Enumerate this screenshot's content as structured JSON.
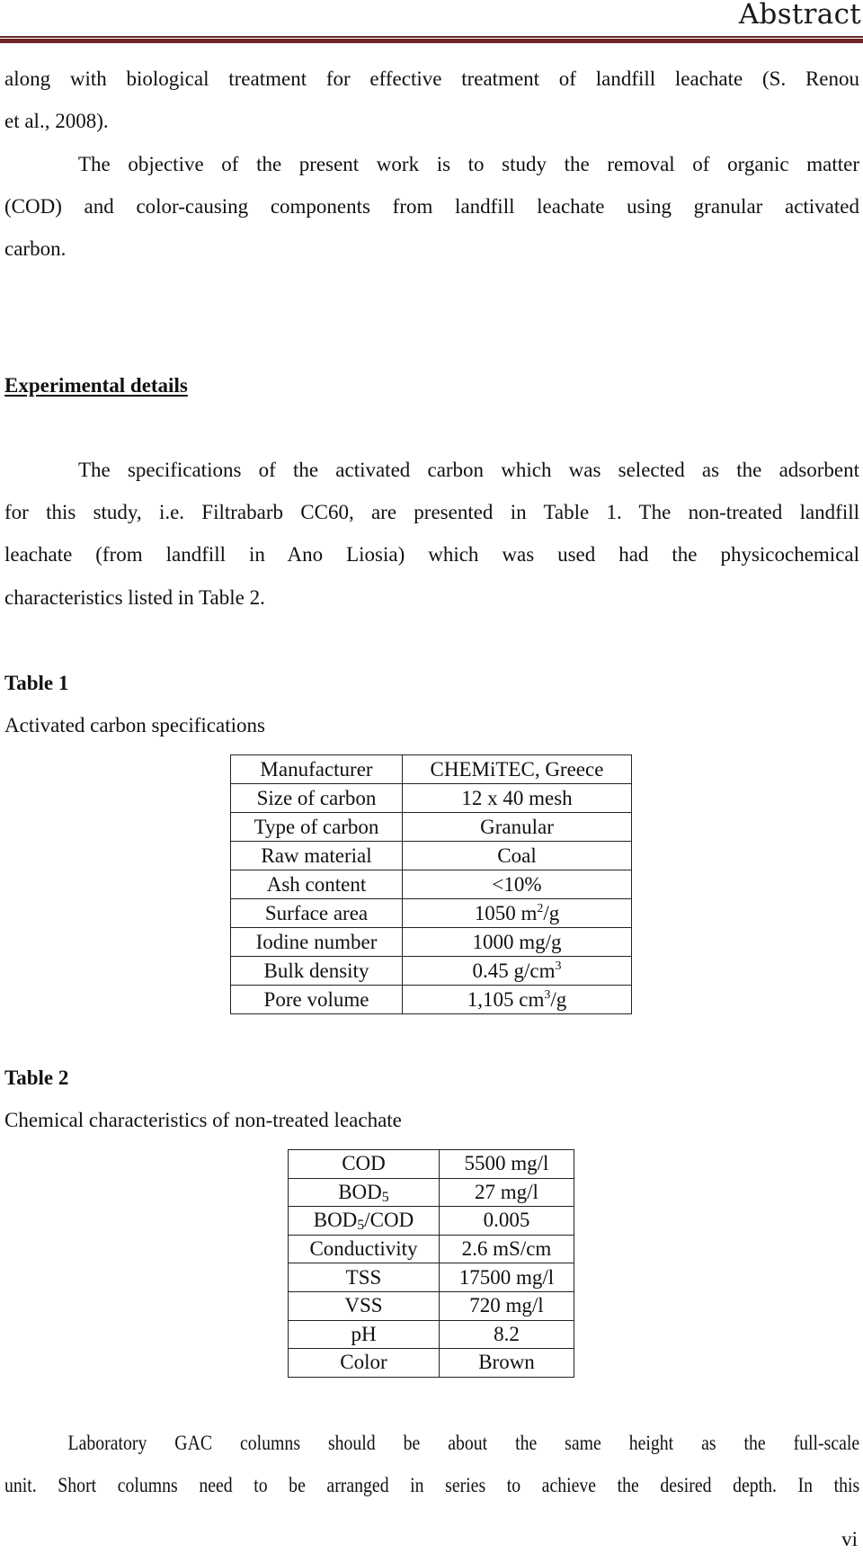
{
  "header": {
    "title": "Abstract",
    "rule_color": "#6f2427"
  },
  "body": {
    "para1": {
      "line1": "along with biological treatment for effective treatment of landfill leachate (S. Renou",
      "line2": "et al., 2008)."
    },
    "para2": {
      "line1": "The objective of the present work is to study the removal of organic matter",
      "line2": "(COD) and color-causing components from landfill leachate using granular activated",
      "line3": "carbon."
    },
    "section_heading": "Experimental details",
    "para3": {
      "line1": "The specifications of the activated carbon which was selected as the adsorbent",
      "line2": "for this study, i.e. Filtrabarb CC60, are presented in Table 1. The non-treated landfill",
      "line3": "leachate (from landfill in Ano Liosia) which was used had the physicochemical",
      "line4": "characteristics listed in Table 2."
    },
    "table1": {
      "label": "Table 1",
      "caption": "Activated carbon specifications",
      "rows": [
        {
          "property": "Manufacturer",
          "value": "CHEMiTEC, Greece",
          "sup": ""
        },
        {
          "property": "Size of carbon",
          "value": "12 x 40 mesh",
          "sup": ""
        },
        {
          "property": "Type of carbon",
          "value": "Granular",
          "sup": ""
        },
        {
          "property": "Raw material",
          "value": "Coal",
          "sup": ""
        },
        {
          "property": "Ash content",
          "value": "<10%",
          "sup": ""
        },
        {
          "property": "Surface area",
          "value_pre": "1050 m",
          "sup": "2",
          "value_post": "/g"
        },
        {
          "property": "Iodine number",
          "value": "1000 mg/g",
          "sup": ""
        },
        {
          "property": "Bulk density",
          "value_pre": "0.45 g/cm",
          "sup": "3",
          "value_post": ""
        },
        {
          "property": "Pore volume",
          "value_pre": "1,105 cm",
          "sup": "3",
          "value_post": "/g"
        }
      ]
    },
    "table2": {
      "label": "Table 2",
      "caption": "Chemical characteristics of non-treated leachate",
      "rows": [
        {
          "parameter": "COD",
          "value": "5500 mg/l"
        },
        {
          "parameter_pre": "BOD",
          "parameter_sub": "5",
          "parameter_post": "",
          "value": "27 mg/l"
        },
        {
          "parameter_pre": "BOD",
          "parameter_sub": "5",
          "parameter_post": "/COD",
          "value": "0.005"
        },
        {
          "parameter": "Conductivity",
          "value": "2.6 mS/cm"
        },
        {
          "parameter": "TSS",
          "value": "17500 mg/l"
        },
        {
          "parameter": "VSS",
          "value": "720 mg/l"
        },
        {
          "parameter": "pH",
          "value": "8.2"
        },
        {
          "parameter": "Color",
          "value": "Brown"
        }
      ]
    },
    "para4": {
      "line1": "Laboratory GAC columns should be about the same height as the full-scale",
      "line2": "unit. Short columns need to be arranged in series to achieve the desired depth. In this"
    }
  },
  "footer": {
    "page_number": "vi"
  }
}
